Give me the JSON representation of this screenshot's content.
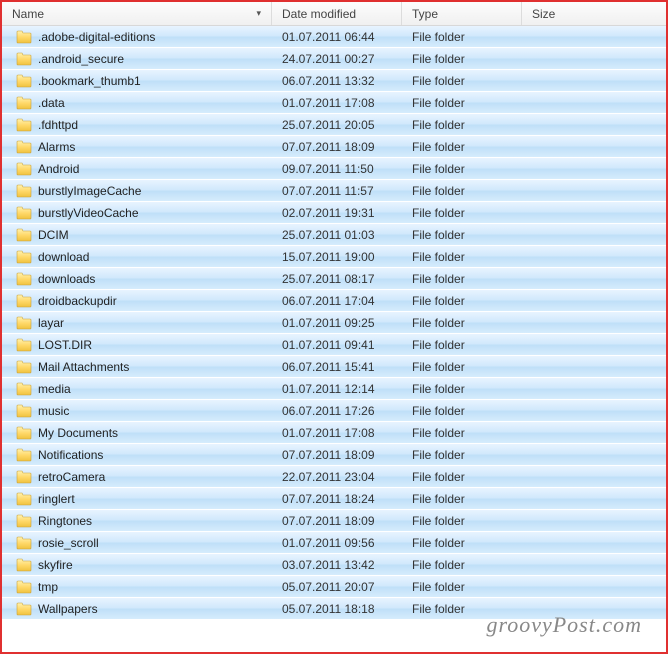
{
  "columns": {
    "name": "Name",
    "date": "Date modified",
    "type": "Type",
    "size": "Size",
    "sort_indicator": "▾"
  },
  "type_label": "File folder",
  "files": [
    {
      "name": ".adobe-digital-editions",
      "date": "01.07.2011 06:44"
    },
    {
      "name": ".android_secure",
      "date": "24.07.2011 00:27"
    },
    {
      "name": ".bookmark_thumb1",
      "date": "06.07.2011 13:32"
    },
    {
      "name": ".data",
      "date": "01.07.2011 17:08"
    },
    {
      "name": ".fdhttpd",
      "date": "25.07.2011 20:05"
    },
    {
      "name": "Alarms",
      "date": "07.07.2011 18:09"
    },
    {
      "name": "Android",
      "date": "09.07.2011 11:50"
    },
    {
      "name": "burstlyImageCache",
      "date": "07.07.2011 11:57"
    },
    {
      "name": "burstlyVideoCache",
      "date": "02.07.2011 19:31"
    },
    {
      "name": "DCIM",
      "date": "25.07.2011 01:03"
    },
    {
      "name": "download",
      "date": "15.07.2011 19:00"
    },
    {
      "name": "downloads",
      "date": "25.07.2011 08:17"
    },
    {
      "name": "droidbackupdir",
      "date": "06.07.2011 17:04"
    },
    {
      "name": "layar",
      "date": "01.07.2011 09:25"
    },
    {
      "name": "LOST.DIR",
      "date": "01.07.2011 09:41"
    },
    {
      "name": "Mail Attachments",
      "date": "06.07.2011 15:41"
    },
    {
      "name": "media",
      "date": "01.07.2011 12:14"
    },
    {
      "name": "music",
      "date": "06.07.2011 17:26"
    },
    {
      "name": "My Documents",
      "date": "01.07.2011 17:08"
    },
    {
      "name": "Notifications",
      "date": "07.07.2011 18:09"
    },
    {
      "name": "retroCamera",
      "date": "22.07.2011 23:04"
    },
    {
      "name": "ringlert",
      "date": "07.07.2011 18:24"
    },
    {
      "name": "Ringtones",
      "date": "07.07.2011 18:09"
    },
    {
      "name": "rosie_scroll",
      "date": "01.07.2011 09:56"
    },
    {
      "name": "skyfire",
      "date": "03.07.2011 13:42"
    },
    {
      "name": "tmp",
      "date": "05.07.2011 20:07"
    },
    {
      "name": "Wallpapers",
      "date": "05.07.2011 18:18"
    }
  ],
  "watermark": "groovyPost.com"
}
